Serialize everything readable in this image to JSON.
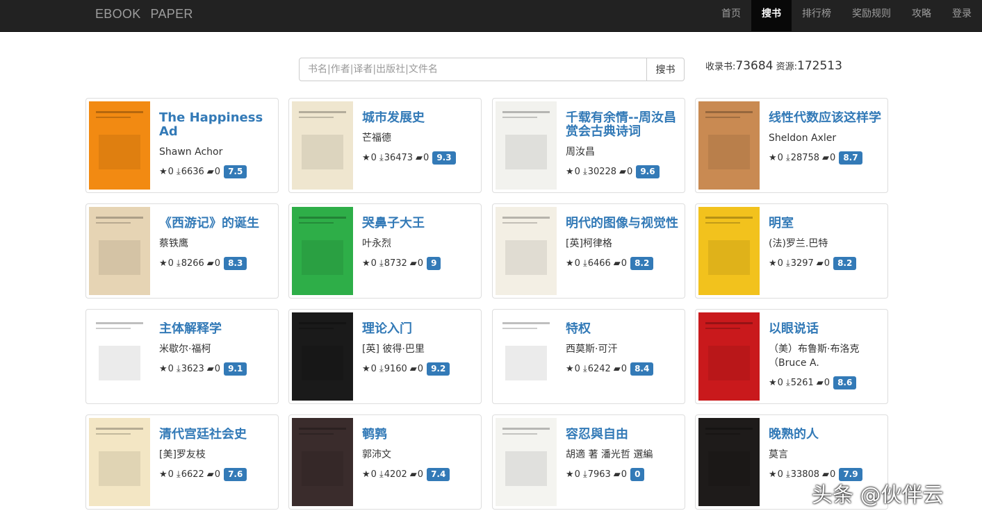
{
  "navbar": {
    "brand_left": "EBOOK",
    "brand_right": "PAPER",
    "items": [
      {
        "label": "首页",
        "active": false
      },
      {
        "label": "搜书",
        "active": true
      },
      {
        "label": "排行榜",
        "active": false
      },
      {
        "label": "奖励规则",
        "active": false
      },
      {
        "label": "攻略",
        "active": false
      },
      {
        "label": "登录",
        "active": false
      }
    ]
  },
  "search": {
    "placeholder": "书名|作者|译者|出版社|文件名",
    "value": "",
    "button_label": "搜书"
  },
  "stats": {
    "books_label": "收录书:",
    "books_count": "73684",
    "resources_label": "资源:",
    "resources_count": "172513"
  },
  "books": [
    {
      "title": "The Happiness Ad",
      "author": "Shawn Achor",
      "stars": "0",
      "downloads": "6636",
      "comments": "0",
      "rating": "7.5",
      "cover_color": "#f28a12"
    },
    {
      "title": "城市发展史",
      "author": "芒福德",
      "stars": "0",
      "downloads": "36473",
      "comments": "0",
      "rating": "9.3",
      "cover_color": "#efe6cf"
    },
    {
      "title": "千载有余情--周汝昌赏会古典诗词",
      "author": "周汝昌",
      "stars": "0",
      "downloads": "30228",
      "comments": "0",
      "rating": "9.6",
      "cover_color": "#f2f2ee"
    },
    {
      "title": "线性代数应该这样学",
      "author": "Sheldon Axler",
      "stars": "0",
      "downloads": "28758",
      "comments": "0",
      "rating": "8.7",
      "cover_color": "#c98a52"
    },
    {
      "title": "《西游记》的诞生",
      "author": "蔡铁鹰",
      "stars": "0",
      "downloads": "8266",
      "comments": "0",
      "rating": "8.3",
      "cover_color": "#e6d4b4"
    },
    {
      "title": "哭鼻子大王",
      "author": "叶永烈",
      "stars": "0",
      "downloads": "8732",
      "comments": "0",
      "rating": "9",
      "cover_color": "#2eae48"
    },
    {
      "title": "明代的图像与视觉性",
      "author": "[英]柯律格",
      "stars": "0",
      "downloads": "6466",
      "comments": "0",
      "rating": "8.2",
      "cover_color": "#f3efe4"
    },
    {
      "title": "明室",
      "author": "(法)罗兰.巴特",
      "stars": "0",
      "downloads": "3297",
      "comments": "0",
      "rating": "8.2",
      "cover_color": "#f2c21d"
    },
    {
      "title": "主体解释学",
      "author": "米歇尔·福柯",
      "stars": "0",
      "downloads": "3623",
      "comments": "0",
      "rating": "9.1",
      "cover_color": "#ffffff"
    },
    {
      "title": "理论入门",
      "author": "[英] 彼得·巴里",
      "stars": "0",
      "downloads": "9160",
      "comments": "0",
      "rating": "9.2",
      "cover_color": "#1a1a1a"
    },
    {
      "title": "特权",
      "author": "西莫斯·可汗",
      "stars": "0",
      "downloads": "6242",
      "comments": "0",
      "rating": "8.4",
      "cover_color": "#ffffff"
    },
    {
      "title": "以眼说话",
      "author": "（美）布鲁斯·布洛克（Bruce A.",
      "stars": "0",
      "downloads": "5261",
      "comments": "0",
      "rating": "8.6",
      "cover_color": "#c9191c"
    },
    {
      "title": "清代宫廷社会史",
      "author": "[美]罗友枝",
      "stars": "0",
      "downloads": "6622",
      "comments": "0",
      "rating": "7.6",
      "cover_color": "#f3e6c4"
    },
    {
      "title": "鹌鹑",
      "author": "郭沛文",
      "stars": "0",
      "downloads": "4202",
      "comments": "0",
      "rating": "7.4",
      "cover_color": "#3a2c2c"
    },
    {
      "title": "容忍與自由",
      "author": "胡適 著 潘光哲 選編",
      "stars": "0",
      "downloads": "7963",
      "comments": "0",
      "rating": "0",
      "cover_color": "#f4f4f0"
    },
    {
      "title": "晚熟的人",
      "author": "莫言",
      "stars": "0",
      "downloads": "33808",
      "comments": "0",
      "rating": "7.9",
      "cover_color": "#1e1b1a"
    }
  ],
  "watermark": "头条 @伙伴云"
}
